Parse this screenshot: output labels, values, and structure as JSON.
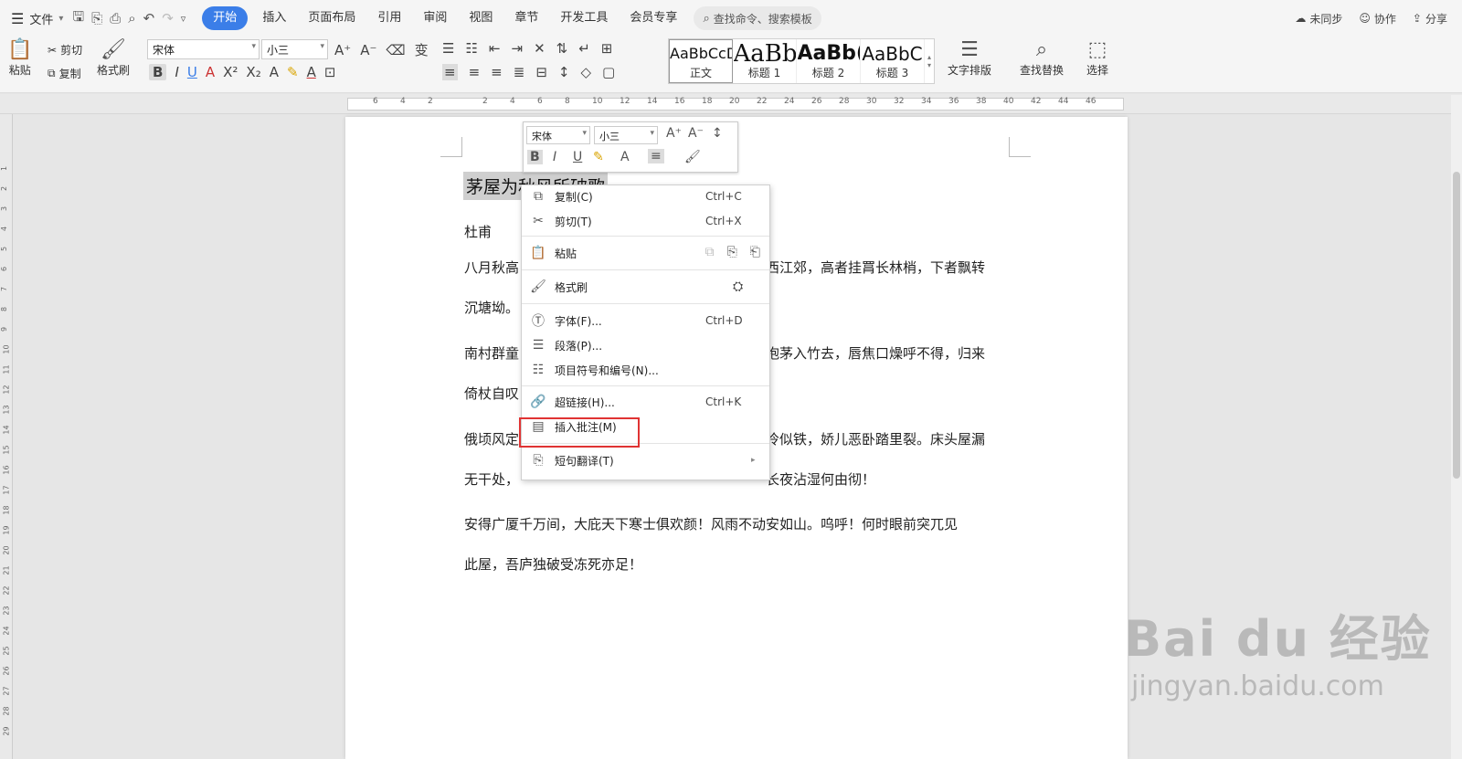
{
  "menubar": {
    "file_label": "文件",
    "tabs": [
      "开始",
      "插入",
      "页面布局",
      "引用",
      "审阅",
      "视图",
      "章节",
      "开发工具",
      "会员专享"
    ],
    "active_tab": "开始",
    "search_placeholder": "查找命令、搜索模板",
    "right": {
      "sync": "未同步",
      "collab": "协作",
      "share": "分享"
    }
  },
  "ribbon": {
    "paste": "粘贴",
    "cut": "剪切",
    "copy": "复制",
    "format_painter": "格式刷",
    "font_name": "宋体",
    "font_size": "小三",
    "styles": [
      {
        "sample": "AaBbCcDc",
        "name": "正文"
      },
      {
        "sample": "AaBb",
        "name": "标题 1"
      },
      {
        "sample": "AaBb(",
        "name": "标题 2"
      },
      {
        "sample": "AaBbC",
        "name": "标题 3"
      }
    ],
    "text_layout": "文字排版",
    "find_replace": "查找替换",
    "select": "选择"
  },
  "ruler": {
    "ticks": [
      "6",
      "4",
      "2",
      "",
      "2",
      "4",
      "6",
      "8",
      "10",
      "12",
      "14",
      "16",
      "18",
      "20",
      "22",
      "24",
      "26",
      "28",
      "30",
      "32",
      "34",
      "36",
      "38",
      "40",
      "42",
      "44",
      "46"
    ]
  },
  "vruler": {
    "ticks": [
      "1",
      "2",
      "3",
      "4",
      "5",
      "6",
      "7",
      "8",
      "9",
      "10",
      "11",
      "12",
      "13",
      "14",
      "15",
      "16",
      "17",
      "18",
      "19",
      "20",
      "21",
      "22",
      "23",
      "24",
      "25",
      "26",
      "27",
      "28",
      "29"
    ]
  },
  "document": {
    "title": "茅屋为秋风所破歌",
    "author": "杜甫",
    "lines": [
      {
        "left": "八月秋高",
        "right": "西江郊，高者挂罥长林梢，下者飘转"
      },
      {
        "left": "沉塘坳。",
        "right": ""
      },
      {
        "left": "南村群童",
        "right": "抱茅入竹去，唇焦口燥呼不得，归来"
      },
      {
        "left": "倚杖自叹",
        "right": ""
      },
      {
        "left": "俄顷风定",
        "right": "冷似铁，娇儿恶卧踏里裂。床头屋漏"
      },
      {
        "left": "无干处，",
        "right": "长夜沾湿何由彻！"
      },
      {
        "left": "安得广厦千万间，大庇天下寒士俱欢颜！风雨不动安如山。呜呼！何时眼前突兀见",
        "right": ""
      },
      {
        "left": "此屋，吾庐独破受冻死亦足！",
        "right": ""
      }
    ]
  },
  "mini_toolbar": {
    "font_name": "宋体",
    "font_size": "小三"
  },
  "context_menu": {
    "items": [
      {
        "label": "复制(C)",
        "shortcut": "Ctrl+C"
      },
      {
        "label": "剪切(T)",
        "shortcut": "Ctrl+X"
      },
      {
        "label": "粘贴",
        "shortcut": ""
      },
      {
        "label": "格式刷",
        "shortcut": ""
      },
      {
        "label": "字体(F)...",
        "shortcut": "Ctrl+D"
      },
      {
        "label": "段落(P)...",
        "shortcut": ""
      },
      {
        "label": "项目符号和编号(N)...",
        "shortcut": ""
      },
      {
        "label": "超链接(H)...",
        "shortcut": "Ctrl+K"
      },
      {
        "label": "插入批注(M)",
        "shortcut": ""
      },
      {
        "label": "短句翻译(T)",
        "shortcut": ""
      }
    ]
  },
  "watermark": {
    "logo": "Bai du 经验",
    "url": "jingyan.baidu.com"
  },
  "colors": {
    "accent": "#3b7ee8",
    "highlight_box": "#e03333"
  }
}
